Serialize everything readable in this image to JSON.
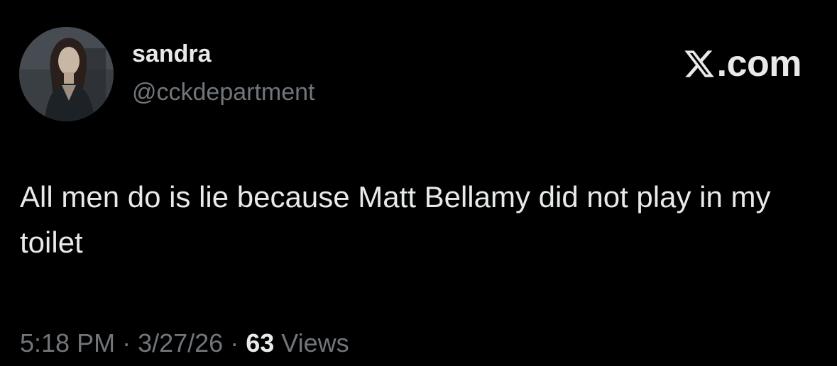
{
  "author": {
    "name": "sandra",
    "handle": "@cckdepartment",
    "avatar_icon": "profile-photo"
  },
  "brand": {
    "icon": "x-logo-icon",
    "label": ".com"
  },
  "tweet": {
    "text": "All men do is lie because Matt Bellamy did not play in my toilet"
  },
  "meta": {
    "time": "5:18 PM",
    "separator_1": " · ",
    "date": "3/27/26",
    "separator_2": " · ",
    "views_count": "63",
    "views_label": " Views"
  },
  "colors": {
    "background": "#000000",
    "primary_text": "#e7e9ea",
    "secondary_text": "#71767b"
  }
}
